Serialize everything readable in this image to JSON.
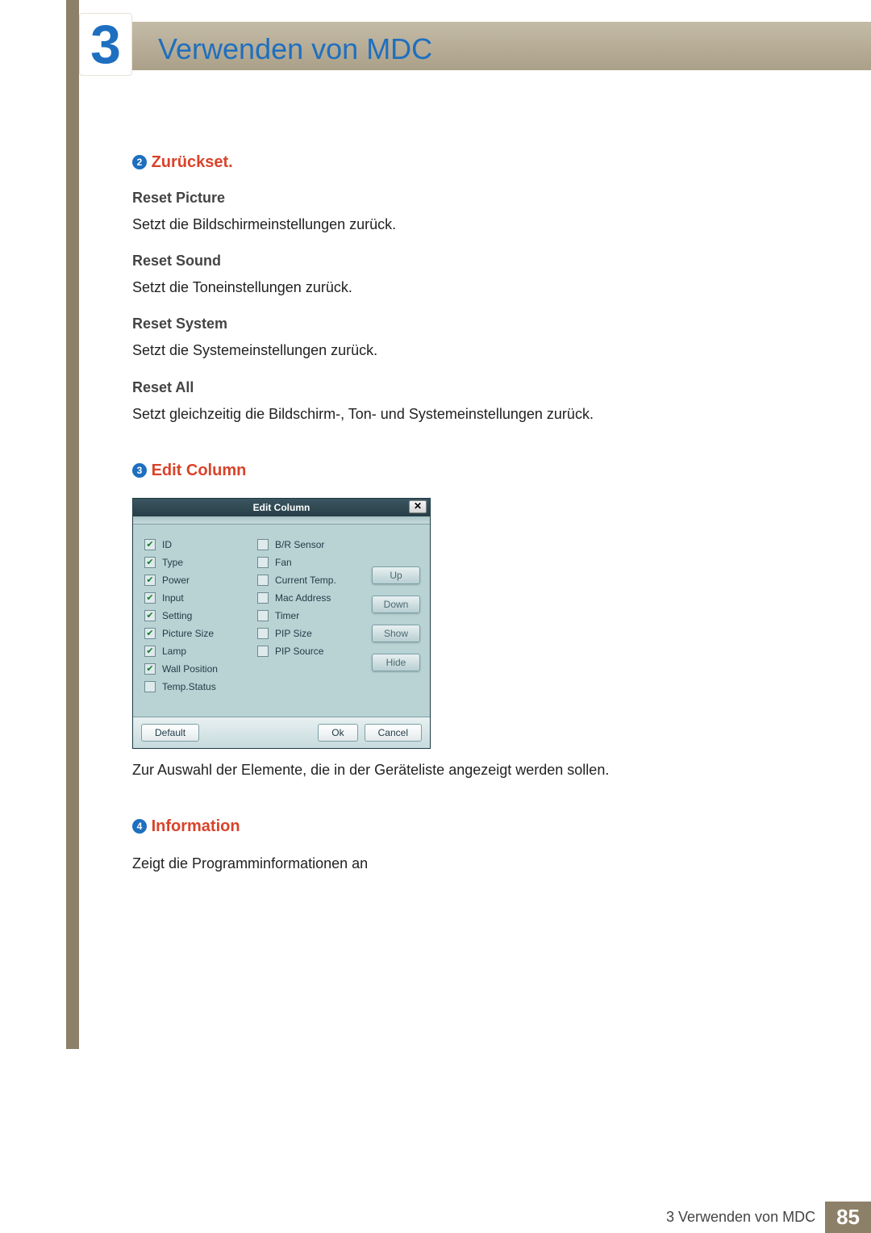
{
  "chapter": {
    "number": "3",
    "title": "Verwenden von MDC"
  },
  "sections": {
    "s2": {
      "bullet": "2",
      "title": "Zurückset.",
      "items": [
        {
          "h": "Reset Picture",
          "p": "Setzt die Bildschirmeinstellungen zurück."
        },
        {
          "h": "Reset Sound",
          "p": "Setzt die Toneinstellungen zurück."
        },
        {
          "h": "Reset System",
          "p": "Setzt die Systemeinstellungen zurück."
        },
        {
          "h": "Reset All",
          "p": "Setzt gleichzeitig die Bildschirm-, Ton- und Systemeinstellungen zurück."
        }
      ]
    },
    "s3": {
      "bullet": "3",
      "title": "Edit Column",
      "dialog": {
        "title": "Edit Column",
        "close": "✕",
        "col1": [
          {
            "label": "ID",
            "checked": true
          },
          {
            "label": "Type",
            "checked": true
          },
          {
            "label": "Power",
            "checked": true
          },
          {
            "label": "Input",
            "checked": true
          },
          {
            "label": "Setting",
            "checked": true
          },
          {
            "label": "Picture Size",
            "checked": true
          },
          {
            "label": "Lamp",
            "checked": true
          },
          {
            "label": "Wall Position",
            "checked": true
          },
          {
            "label": "Temp.Status",
            "checked": false
          }
        ],
        "col2": [
          {
            "label": "B/R Sensor",
            "checked": false
          },
          {
            "label": "Fan",
            "checked": false
          },
          {
            "label": "Current Temp.",
            "checked": false
          },
          {
            "label": "Mac Address",
            "checked": false
          },
          {
            "label": "Timer",
            "checked": false
          },
          {
            "label": "PIP Size",
            "checked": false
          },
          {
            "label": "PIP Source",
            "checked": false
          }
        ],
        "side": {
          "up": "Up",
          "down": "Down",
          "show": "Show",
          "hide": "Hide"
        },
        "footer": {
          "default": "Default",
          "ok": "Ok",
          "cancel": "Cancel"
        }
      },
      "caption": "Zur Auswahl der Elemente, die in der Geräteliste angezeigt werden sollen."
    },
    "s4": {
      "bullet": "4",
      "title": "Information",
      "body": "Zeigt die Programminformationen an"
    }
  },
  "footer": {
    "label": "3 Verwenden von MDC",
    "page": "85"
  }
}
